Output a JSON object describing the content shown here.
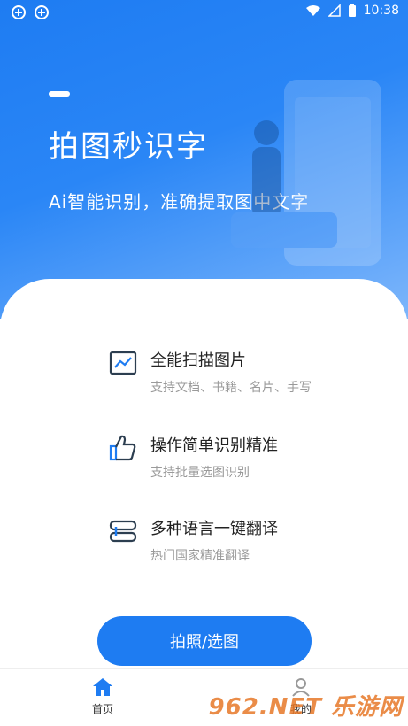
{
  "status_bar": {
    "time": "10:38"
  },
  "hero": {
    "title": "拍图秒识字",
    "subtitle": "Ai智能识别，准确提取图中文字"
  },
  "features": [
    {
      "icon": "image-scan-icon",
      "title": "全能扫描图片",
      "desc": "支持文档、书籍、名片、手写"
    },
    {
      "icon": "thumbs-up-icon",
      "title": "操作简单识别精准",
      "desc": "支持批量选图识别"
    },
    {
      "icon": "translate-icon",
      "title": "多种语言一键翻译",
      "desc": "热门国家精准翻译"
    }
  ],
  "cta": {
    "label": "拍照/选图"
  },
  "tabs": [
    {
      "icon": "home-icon",
      "label": "首页"
    },
    {
      "icon": "user-icon",
      "label": "我的"
    }
  ],
  "watermark": {
    "text": "962.NET 乐游网"
  },
  "colors": {
    "primary": "#1e7cf2",
    "text": "#222222",
    "muted": "#9a9a9a"
  }
}
